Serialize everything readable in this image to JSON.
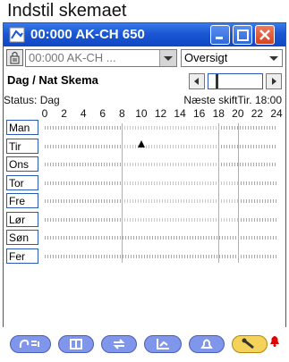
{
  "caption": "Indstil skemaet",
  "window": {
    "title": "00:000 AK-CH 650"
  },
  "toolbar": {
    "device_select": "00:000 AK-CH ...",
    "view_select": "Oversigt"
  },
  "schedule": {
    "heading": "Dag / Nat Skema",
    "status": "Status: Dag",
    "next_shift": "Næste skiftTir. 18:00",
    "hours": [
      "0",
      "2",
      "4",
      "6",
      "8",
      "10",
      "12",
      "14",
      "16",
      "18",
      "20",
      "22",
      "24"
    ],
    "days": [
      "Man",
      "Tir",
      "Ons",
      "Tor",
      "Fre",
      "Lør",
      "Søn",
      "Fer"
    ],
    "day_periods": [
      {
        "day": "Man",
        "start": 8,
        "end": 18
      },
      {
        "day": "Tir",
        "start": 8,
        "end": 18
      },
      {
        "day": "Ons",
        "start": 8,
        "end": 18
      },
      {
        "day": "Tor",
        "start": 8,
        "end": 20
      },
      {
        "day": "Fre",
        "start": 8,
        "end": 20
      },
      {
        "day": "Lør",
        "start": 8,
        "end": 20
      },
      {
        "day": "Søn",
        "start": 0,
        "end": 0
      },
      {
        "day": "Fer",
        "start": 0,
        "end": 0
      }
    ],
    "current_time_marker": {
      "day": "Tir",
      "hour": 10
    }
  },
  "bottom_nav": [
    "sensor-icon",
    "display-icon",
    "swap-icon",
    "graph-icon",
    "alarm-icon",
    "wrench-icon"
  ],
  "colors": {
    "accent": "#1a56d4",
    "active_tab": "#f5d35a",
    "tab": "#7f96ea",
    "alarm": "#e00000"
  }
}
